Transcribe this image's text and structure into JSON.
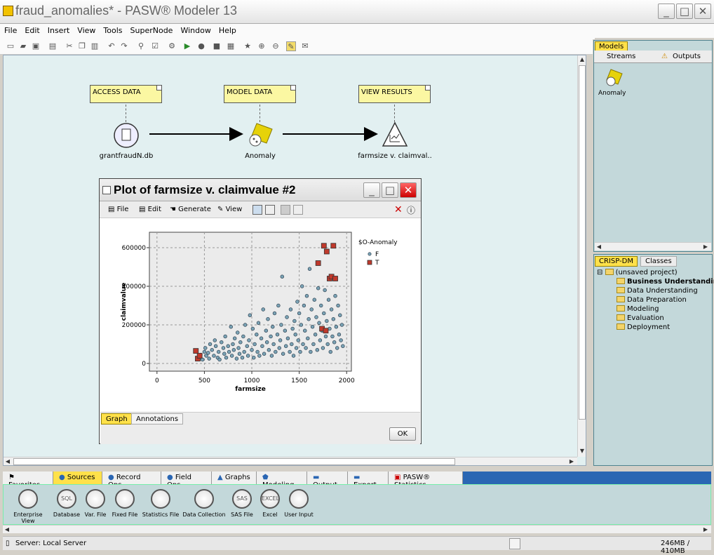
{
  "window": {
    "title": "fraud_anomalies* - PASW® Modeler 13"
  },
  "menu": [
    "File",
    "Edit",
    "Insert",
    "View",
    "Tools",
    "SuperNode",
    "Window",
    "Help"
  ],
  "stream": {
    "notes": [
      "ACCESS DATA",
      "MODEL DATA",
      "VIEW RESULTS"
    ],
    "nodes": [
      "grantfraudN.db",
      "Anomaly",
      "farmsize v. claimval.."
    ]
  },
  "plot": {
    "title": "Plot of farmsize v. claimvalue #2",
    "menu": [
      "File",
      "Edit",
      "Generate",
      "View"
    ],
    "tabs": [
      "Graph",
      "Annotations"
    ],
    "ok": "OK"
  },
  "chart_data": {
    "type": "scatter",
    "title": "",
    "xlabel": "farmsize",
    "ylabel": "claimvalue",
    "xlim": [
      -80,
      2050
    ],
    "ylim": [
      -40000,
      680000
    ],
    "xticks": [
      0,
      500,
      1000,
      1500,
      2000
    ],
    "yticks": [
      0,
      200000,
      400000,
      600000
    ],
    "xticklabels": [
      "0",
      "500",
      "1000",
      "1500",
      "2000"
    ],
    "yticklabels": [
      "0",
      "200000",
      "400000",
      "600000"
    ],
    "grid": true,
    "legend": {
      "title": "$O-Anomaly",
      "position": "right"
    },
    "series": [
      {
        "name": "F",
        "marker": "circle",
        "color": "#7aa3b5",
        "points": [
          [
            440,
            30000
          ],
          [
            460,
            45000
          ],
          [
            480,
            20000
          ],
          [
            500,
            60000
          ],
          [
            510,
            80000
          ],
          [
            520,
            40000
          ],
          [
            540,
            55000
          ],
          [
            550,
            25000
          ],
          [
            560,
            100000
          ],
          [
            580,
            70000
          ],
          [
            600,
            40000
          ],
          [
            610,
            120000
          ],
          [
            620,
            90000
          ],
          [
            640,
            30000
          ],
          [
            650,
            60000
          ],
          [
            660,
            20000
          ],
          [
            680,
            110000
          ],
          [
            700,
            80000
          ],
          [
            710,
            50000
          ],
          [
            720,
            140000
          ],
          [
            730,
            30000
          ],
          [
            750,
            90000
          ],
          [
            760,
            60000
          ],
          [
            780,
            190000
          ],
          [
            790,
            40000
          ],
          [
            800,
            100000
          ],
          [
            810,
            70000
          ],
          [
            820,
            130000
          ],
          [
            840,
            25000
          ],
          [
            850,
            160000
          ],
          [
            860,
            80000
          ],
          [
            870,
            50000
          ],
          [
            880,
            110000
          ],
          [
            900,
            30000
          ],
          [
            910,
            140000
          ],
          [
            920,
            60000
          ],
          [
            930,
            200000
          ],
          [
            950,
            90000
          ],
          [
            960,
            40000
          ],
          [
            970,
            120000
          ],
          [
            980,
            250000
          ],
          [
            1000,
            70000
          ],
          [
            1010,
            180000
          ],
          [
            1020,
            30000
          ],
          [
            1030,
            100000
          ],
          [
            1050,
            150000
          ],
          [
            1060,
            60000
          ],
          [
            1070,
            210000
          ],
          [
            1080,
            40000
          ],
          [
            1100,
            130000
          ],
          [
            1110,
            90000
          ],
          [
            1120,
            280000
          ],
          [
            1130,
            50000
          ],
          [
            1150,
            170000
          ],
          [
            1160,
            110000
          ],
          [
            1170,
            230000
          ],
          [
            1180,
            70000
          ],
          [
            1200,
            140000
          ],
          [
            1210,
            40000
          ],
          [
            1220,
            190000
          ],
          [
            1230,
            100000
          ],
          [
            1240,
            260000
          ],
          [
            1250,
            60000
          ],
          [
            1270,
            150000
          ],
          [
            1280,
            300000
          ],
          [
            1290,
            80000
          ],
          [
            1300,
            120000
          ],
          [
            1310,
            200000
          ],
          [
            1320,
            450000
          ],
          [
            1330,
            50000
          ],
          [
            1350,
            170000
          ],
          [
            1360,
            90000
          ],
          [
            1370,
            240000
          ],
          [
            1380,
            130000
          ],
          [
            1400,
            60000
          ],
          [
            1410,
            280000
          ],
          [
            1420,
            100000
          ],
          [
            1430,
            180000
          ],
          [
            1440,
            40000
          ],
          [
            1450,
            220000
          ],
          [
            1460,
            150000
          ],
          [
            1470,
            80000
          ],
          [
            1480,
            320000
          ],
          [
            1490,
            120000
          ],
          [
            1500,
            260000
          ],
          [
            1510,
            60000
          ],
          [
            1520,
            200000
          ],
          [
            1530,
            400000
          ],
          [
            1540,
            100000
          ],
          [
            1550,
            300000
          ],
          [
            1560,
            170000
          ],
          [
            1570,
            80000
          ],
          [
            1580,
            350000
          ],
          [
            1590,
            130000
          ],
          [
            1600,
            230000
          ],
          [
            1610,
            490000
          ],
          [
            1620,
            60000
          ],
          [
            1630,
            280000
          ],
          [
            1640,
            190000
          ],
          [
            1650,
            100000
          ],
          [
            1660,
            330000
          ],
          [
            1670,
            150000
          ],
          [
            1680,
            240000
          ],
          [
            1690,
            70000
          ],
          [
            1700,
            390000
          ],
          [
            1710,
            210000
          ],
          [
            1720,
            120000
          ],
          [
            1730,
            300000
          ],
          [
            1740,
            170000
          ],
          [
            1750,
            80000
          ],
          [
            1760,
            260000
          ],
          [
            1770,
            380000
          ],
          [
            1780,
            140000
          ],
          [
            1790,
            220000
          ],
          [
            1800,
            100000
          ],
          [
            1810,
            330000
          ],
          [
            1820,
            180000
          ],
          [
            1830,
            60000
          ],
          [
            1840,
            280000
          ],
          [
            1850,
            140000
          ],
          [
            1860,
            230000
          ],
          [
            1870,
            110000
          ],
          [
            1880,
            350000
          ],
          [
            1890,
            190000
          ],
          [
            1900,
            80000
          ],
          [
            1910,
            300000
          ],
          [
            1920,
            150000
          ],
          [
            1930,
            250000
          ],
          [
            1940,
            120000
          ],
          [
            1950,
            200000
          ],
          [
            1960,
            90000
          ]
        ]
      },
      {
        "name": "T",
        "marker": "square",
        "color": "#c0392b",
        "points": [
          [
            410,
            65000
          ],
          [
            430,
            25000
          ],
          [
            450,
            40000
          ],
          [
            1700,
            520000
          ],
          [
            1760,
            610000
          ],
          [
            1790,
            580000
          ],
          [
            1820,
            440000
          ],
          [
            1840,
            450000
          ],
          [
            1860,
            610000
          ],
          [
            1880,
            440000
          ],
          [
            1740,
            180000
          ],
          [
            1780,
            170000
          ]
        ]
      }
    ]
  },
  "right": {
    "models_tab": "Models",
    "models_subtabs": [
      "Streams",
      "Outputs"
    ],
    "model_item": "Anomaly",
    "crisp_tabs": [
      "CRISP-DM",
      "Classes"
    ],
    "project": "(unsaved project)",
    "phases": [
      "Business Understanding",
      "Data Understanding",
      "Data Preparation",
      "Modeling",
      "Evaluation",
      "Deployment"
    ]
  },
  "palette": {
    "tabs": [
      "Favorites",
      "Sources",
      "Record Ops",
      "Field Ops",
      "Graphs",
      "Modeling",
      "Output",
      "Export",
      "PASW® Statistics"
    ],
    "items": [
      "Enterprise View",
      "Database",
      "Var. File",
      "Fixed File",
      "Statistics File",
      "Data Collection",
      "SAS File",
      "Excel",
      "User Input"
    ],
    "icon_glyphs": [
      "",
      "SQL",
      "",
      "",
      "",
      "",
      "SAS",
      "EXCEL",
      ""
    ]
  },
  "status": {
    "server": "Server: Local Server",
    "memory": "246MB / 410MB"
  }
}
